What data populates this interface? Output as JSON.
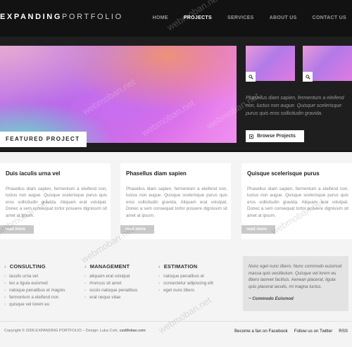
{
  "header": {
    "logo_bold": "EXPANDING",
    "logo_light": "PORTFOLIO",
    "nav": [
      {
        "label": "HOME"
      },
      {
        "label": "PROJECTS"
      },
      {
        "label": "SERVICES"
      },
      {
        "label": "ABOUT US"
      },
      {
        "label": "CONTACT US"
      }
    ],
    "active_nav": "PROJECTS"
  },
  "feature": {
    "hero_label": "FEATURED PROJECT",
    "thumbs": [
      {
        "icon": "search-icon"
      },
      {
        "icon": "search-icon"
      }
    ],
    "description": "Phasellus diam sapien, fermentum a eleifend non, luctus non augue. Quisque scelerisque purus quis eros sollicitudin gravida.",
    "browse_label": "Browse Projects",
    "browse_icon": "square-icon"
  },
  "boxes": [
    {
      "title": "Duis iaculis urna vel",
      "text": "Phasellus diam sapien, fermentum a eleifend non, luctus non augue. Quisque scelerisque purus quis eros sollicitudin gravida. Aliquam erat volutpat. Donec a sem consequat tortor posuere dignissim sit amet at ipsum.",
      "more": "read more"
    },
    {
      "title": "Phasellus diam sapien",
      "text": "Phasellus diam sapien, fermentum a eleifend non, luctus non augue. Quisque scelerisque purus quis eros sollicitudin gravida. Aliquam erat volutpat. Donec a sem consequat tortor posuere dignissim sit amet at ipsum.",
      "more": "read more"
    },
    {
      "title": "Quisque scelerisque purus",
      "text": "Phasellus diam sapien, fermentum a eleifend non, luctus non augue. Quisque scelerisque purus quis eros sollicitudin gravida. Aliquam erat volutpat. Donec a sem consequat tortor posuere dignissim sit amet at ipsum.",
      "more": "read more"
    }
  ],
  "footer": {
    "bullet": "›",
    "columns": [
      {
        "title": "CONSULTING",
        "items": [
          "iaculis urna vel",
          "leo a ligula euismod",
          "natoque penatibus et magnis",
          "fermentum a eleifend non",
          "quisque vel lorem eu"
        ]
      },
      {
        "title": "MANAGEMENT",
        "items": [
          "aliquam erat volutpat",
          "rhoncus sit amet",
          "sociis natoque penatibus",
          "erat neque vitae"
        ]
      },
      {
        "title": "ESTIMATION",
        "items": [
          "natoque penatibus et",
          "consectetur adipiscing elit",
          "eget nunc libero"
        ]
      }
    ],
    "quote": "Nunc eget nunc libero. Nunc commodo euismod massa quis vestibulum. Quisque vel lorem eu libero laoreet facilisis. Aenean placerat, ligula quis placerat iaculis, mi magna luctus.",
    "quote_author": "~ Commodo Euismod"
  },
  "bottom": {
    "copyright": "Copyright © 2009 EXPANDING PORTFOLIO – Design: Luka Cvrk,",
    "copyright_link": "cssMoban.com",
    "links": [
      "Become a fan on Facebook",
      "Follow us on Twitter",
      "RSS"
    ]
  },
  "watermark": "webmoban.net"
}
